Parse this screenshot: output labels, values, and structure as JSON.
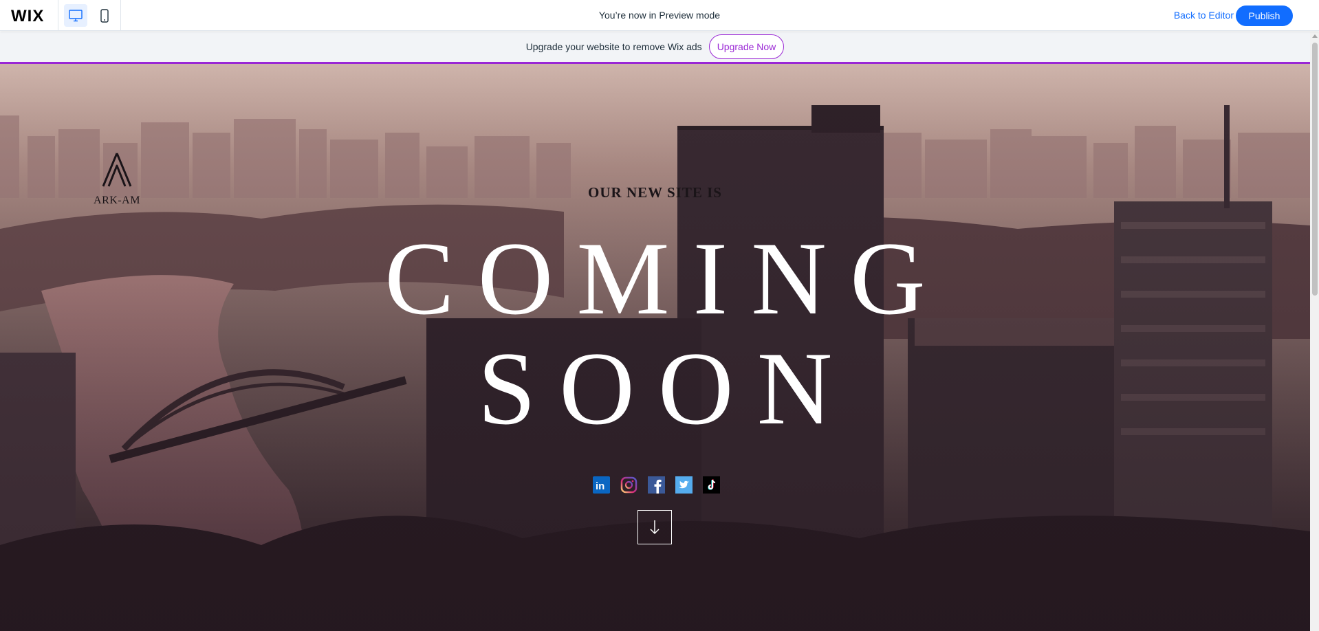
{
  "topbar": {
    "logo": "WIX",
    "preview_message": "You’re now in Preview mode",
    "back_label": "Back to Editor",
    "publish_label": "Publish",
    "devices": [
      "desktop-icon",
      "mobile-icon"
    ],
    "active_device": "desktop"
  },
  "banner": {
    "text": "Upgrade your website to remove Wix ads",
    "button_label": "Upgrade Now"
  },
  "hero": {
    "logo_text": "ARK-AM",
    "subtitle": "OUR NEW SITE IS",
    "title_line1": "COMING",
    "title_line2": "SOON",
    "social": [
      "linkedin-icon",
      "instagram-icon",
      "facebook-icon",
      "twitter-icon",
      "tiktok-icon"
    ],
    "scroll_icon": "arrow-down-icon"
  },
  "colors": {
    "accent_blue": "#116dff",
    "banner_purple": "#9a27d5"
  }
}
